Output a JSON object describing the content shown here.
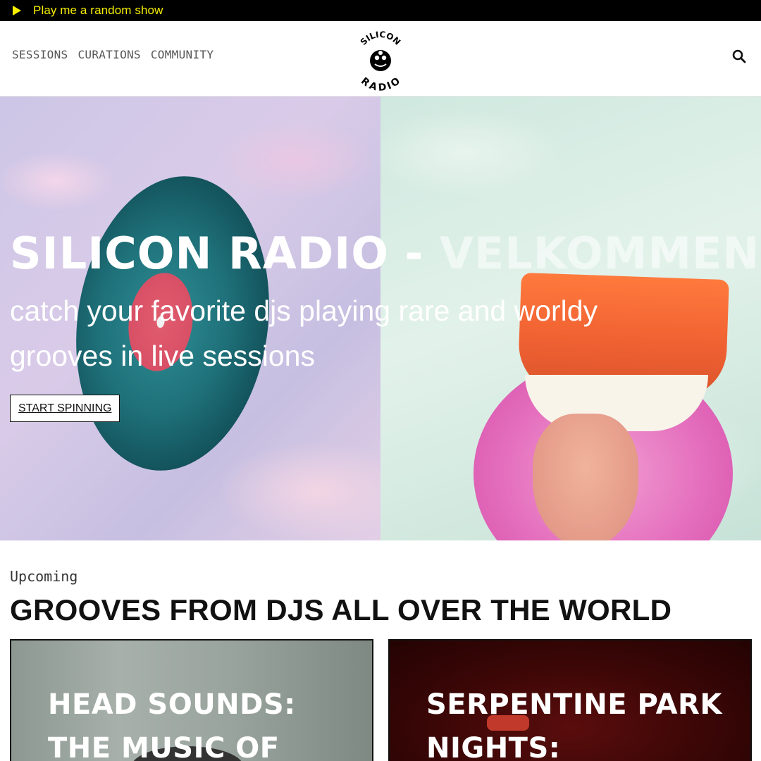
{
  "topbar": {
    "label": "Play me a random show",
    "accent": "#f7ef00"
  },
  "nav": {
    "items": [
      "SESSIONS",
      "CURATIONS",
      "COMMUNITY"
    ]
  },
  "logo": {
    "top": "SILICON",
    "bottom": "RADIO"
  },
  "hero": {
    "title_main": "SILICON RADIO -",
    "title_faded": "VELKOMMEN",
    "subtitle": "catch your favorite djs playing rare and worldy grooves in live sessions",
    "button_label": "START SPINNING"
  },
  "upcoming": {
    "kicker": "Upcoming",
    "title": "GROOVES FROM DJS ALL OVER THE WORLD",
    "cards": [
      {
        "title": "HEAD SOUNDS: THE MUSIC OF"
      },
      {
        "title": "SERPENTINE PARK NIGHTS:"
      }
    ]
  }
}
